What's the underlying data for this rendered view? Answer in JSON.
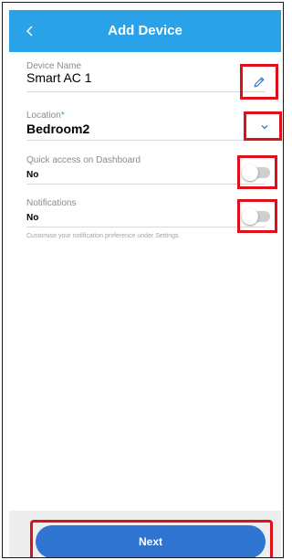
{
  "header": {
    "title": "Add Device",
    "back_icon": "chevron-left-icon",
    "background_color": "#2aa2e8"
  },
  "form": {
    "device_name": {
      "label": "Device Name",
      "value": "Smart AC 1",
      "edit_icon": "pencil-icon"
    },
    "location": {
      "label": "Location",
      "required_mark": "*",
      "value": "Bedroom2",
      "dropdown_icon": "chevron-down-icon"
    },
    "quick_access": {
      "label": "Quick access on Dashboard",
      "value": "No",
      "toggle_on": false
    },
    "notifications": {
      "label": "Notifications",
      "value": "No",
      "toggle_on": false,
      "hint": "Customise your notification preference under Settings."
    }
  },
  "footer": {
    "next_label": "Next",
    "button_color": "#2f74d0"
  },
  "highlight_color": "#e0101a"
}
